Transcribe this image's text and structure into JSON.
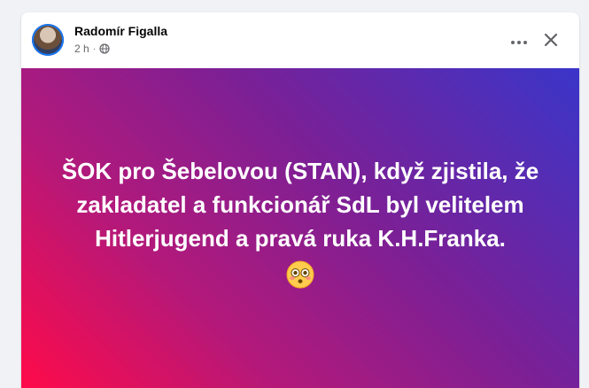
{
  "post": {
    "author": "Radomír Figalla",
    "time": "2 h",
    "separator": "·",
    "audience_icon": "globe-icon",
    "more_icon": "more-dots-icon",
    "close_icon": "close-icon",
    "banner": {
      "text": "ŠOK pro Šebelovou (STAN), když zjistila, že zakladatel a funkcionář SdL byl velitelem Hitlerjugend a pravá ruka K.H.Franka.",
      "emoji": "flushed-face-emoji",
      "gradient_colors": [
        "#ff0a49",
        "#b3197a",
        "#7b2096",
        "#3a35c9"
      ]
    }
  }
}
